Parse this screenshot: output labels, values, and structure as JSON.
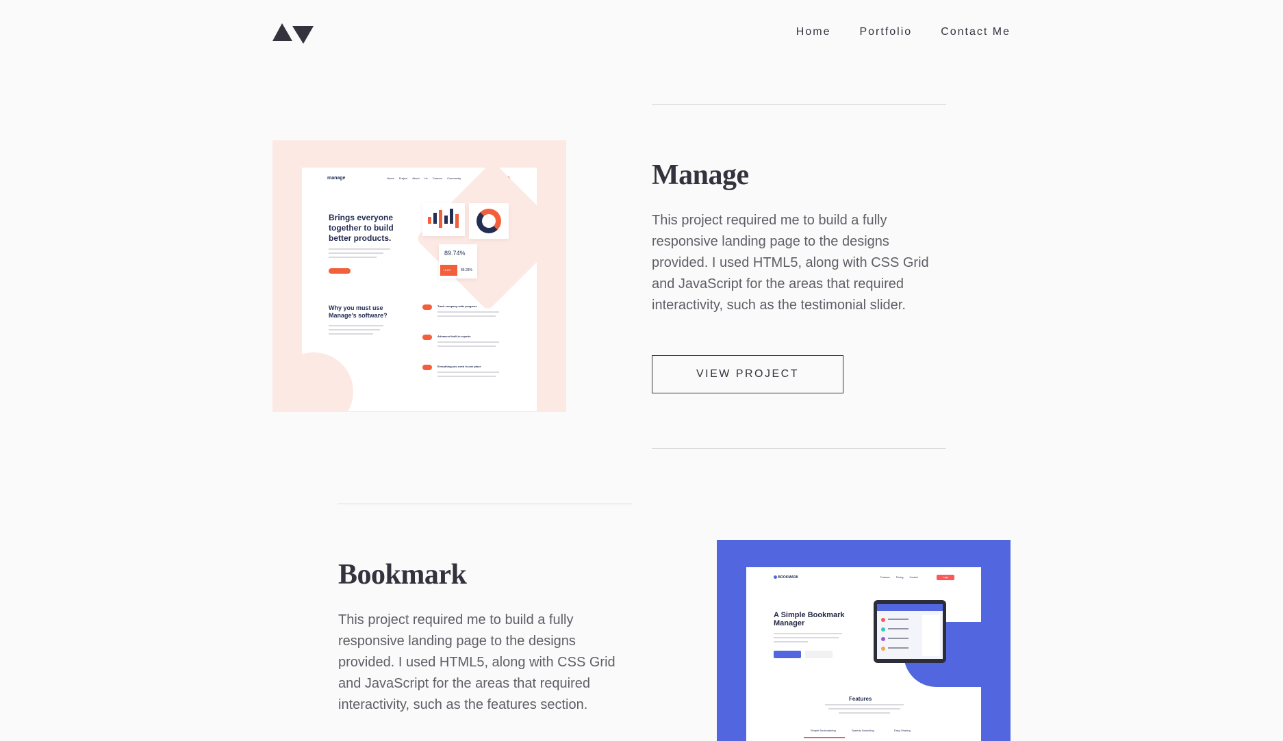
{
  "header": {
    "logo": "logo-mark",
    "nav": [
      "Home",
      "Portfolio",
      "Contact Me"
    ]
  },
  "projects": [
    {
      "title": "Manage",
      "description": "This project required me to build a fully responsive landing page to the designs provided. I used HTML5, along with CSS Grid and JavaScript for the areas that required interactivity, such as the testimonial slider.",
      "button": "VIEW PROJECT",
      "preview": {
        "brand": "manage",
        "nav": [
          "Home",
          "Project",
          "About Us",
          "Careers",
          "Community"
        ],
        "cta": "Get Started",
        "headline": "Brings everyone together to build better products.",
        "section_title": "Why you must use Manage's software?",
        "features": [
          "Track company-wide progress",
          "Advanced built-in reports",
          "Everything you need in one place"
        ],
        "stat": "89.74%",
        "stat_small_a": "+1.8%",
        "stat_small_b": "86.28%",
        "accent": "#f25f3a"
      }
    },
    {
      "title": "Bookmark",
      "description": "This project required me to build a fully responsive landing page to the designs provided. I used HTML5, along with CSS Grid and JavaScript for the areas that required interactivity, such as the features section.",
      "preview": {
        "brand": "BOOKMARK",
        "nav": [
          "Features",
          "Pricing",
          "Contact"
        ],
        "login": "Login",
        "headline": "A Simple Bookmark Manager",
        "section_title": "Features",
        "tabs": [
          "Simple Bookmarking",
          "Speedy Searching",
          "Easy Sharing"
        ],
        "accent": "#5267df"
      }
    }
  ]
}
